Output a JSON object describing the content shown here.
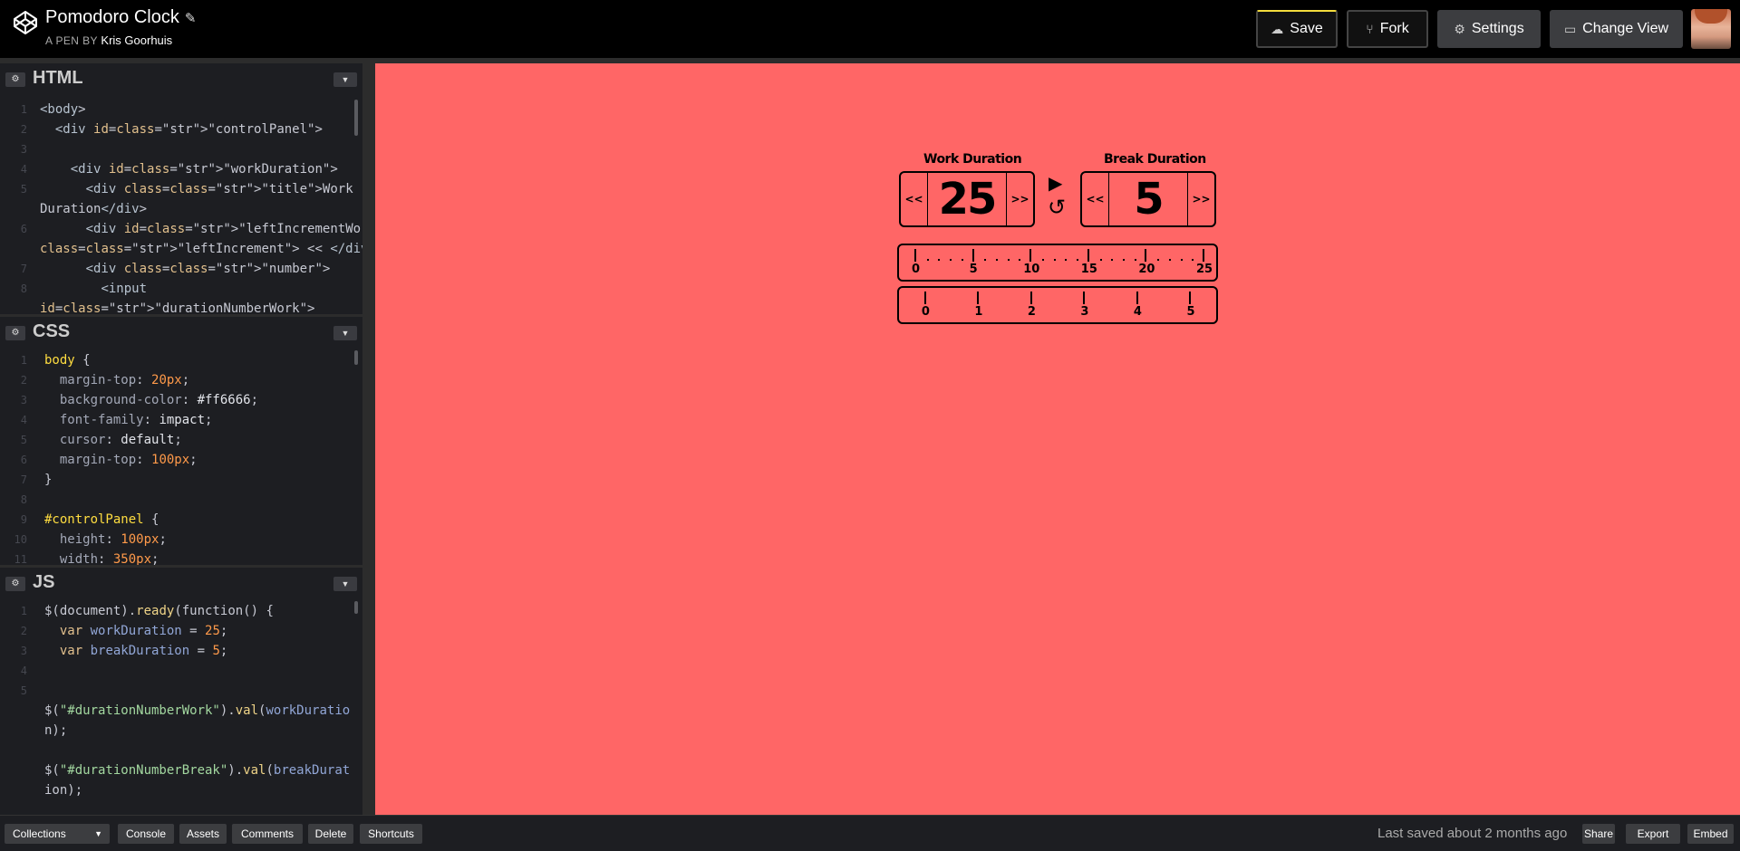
{
  "header": {
    "title": "Pomodoro Clock",
    "author_prefix": "A PEN BY",
    "author": "Kris Goorhuis",
    "buttons": {
      "save": "Save",
      "fork": "Fork",
      "settings": "Settings",
      "change_view": "Change View"
    }
  },
  "editors": {
    "html": {
      "title": "HTML",
      "lines": [
        {
          "n": "1",
          "t": "<body>"
        },
        {
          "n": "2",
          "t": "  <div id=\"controlPanel\">"
        },
        {
          "n": "3",
          "t": ""
        },
        {
          "n": "4",
          "t": "    <div id=\"workDuration\">"
        },
        {
          "n": "5",
          "t": "      <div class=\"title\">Work"
        },
        {
          "n": "",
          "t": "Duration</div>"
        },
        {
          "n": "6",
          "t": "      <div id=\"leftIncrementWork\""
        },
        {
          "n": "",
          "t": "class=\"leftIncrement\"> << </div>"
        },
        {
          "n": "7",
          "t": "      <div class=\"number\">"
        },
        {
          "n": "8",
          "t": "        <input"
        },
        {
          "n": "",
          "t": "id=\"durationNumberWork\">"
        }
      ]
    },
    "css": {
      "title": "CSS",
      "lines": [
        {
          "n": "1",
          "t": "body {"
        },
        {
          "n": "2",
          "t": "  margin-top: 20px;"
        },
        {
          "n": "3",
          "t": "  background-color: #ff6666;"
        },
        {
          "n": "4",
          "t": "  font-family: impact;"
        },
        {
          "n": "5",
          "t": "  cursor: default;"
        },
        {
          "n": "6",
          "t": "  margin-top: 100px;"
        },
        {
          "n": "7",
          "t": "}"
        },
        {
          "n": "8",
          "t": ""
        },
        {
          "n": "9",
          "t": "#controlPanel {"
        },
        {
          "n": "10",
          "t": "  height: 100px;"
        },
        {
          "n": "11",
          "t": "  width: 350px;"
        }
      ]
    },
    "js": {
      "title": "JS",
      "lines": [
        {
          "n": "1",
          "t": "$(document).ready(function() {"
        },
        {
          "n": "2",
          "t": "  var workDuration = 25;"
        },
        {
          "n": "3",
          "t": "  var breakDuration = 5;"
        },
        {
          "n": "4",
          "t": ""
        },
        {
          "n": "5",
          "t": ""
        },
        {
          "n": "",
          "t": "$(\"#durationNumberWork\").val(workDuratio"
        },
        {
          "n": "",
          "t": "n);"
        },
        {
          "n": "",
          "t": ""
        },
        {
          "n": "",
          "t": "$(\"#durationNumberBreak\").val(breakDurat"
        },
        {
          "n": "",
          "t": "ion);"
        }
      ]
    }
  },
  "preview": {
    "background": "#ff6666",
    "work": {
      "title": "Work Duration",
      "left": "<<",
      "right": ">>",
      "value": "25"
    },
    "break": {
      "title": "Break Duration",
      "left": "<<",
      "right": ">>",
      "value": "5"
    },
    "play_icon": "play-icon",
    "reset_icon": "reset-icon",
    "work_ruler_labels": [
      "0",
      "5",
      "10",
      "15",
      "20",
      "25"
    ],
    "break_ruler_labels": [
      "0",
      "1",
      "2",
      "3",
      "4",
      "5"
    ]
  },
  "footer": {
    "collections": "Collections",
    "console": "Console",
    "assets": "Assets",
    "comments": "Comments",
    "delete": "Delete",
    "shortcuts": "Shortcuts",
    "last_saved": "Last saved about 2 months ago",
    "share": "Share",
    "export": "Export",
    "embed": "Embed"
  }
}
